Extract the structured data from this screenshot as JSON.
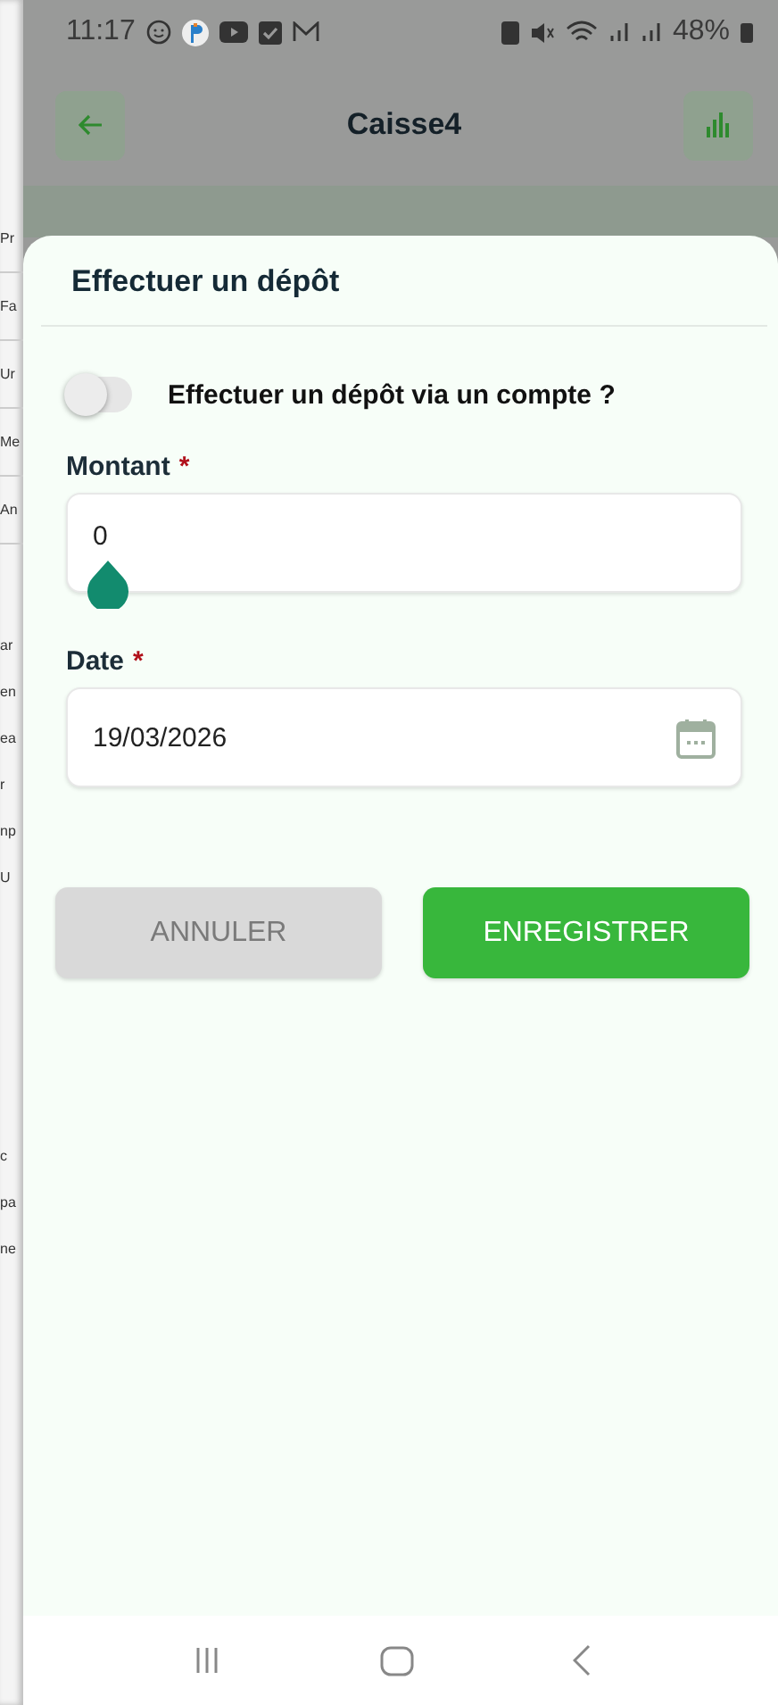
{
  "status_bar": {
    "time": "11:17",
    "battery": "48%"
  },
  "background_app": {
    "title": "Caisse4"
  },
  "side_strip": [
    {
      "text": "Pr",
      "kind": "row"
    },
    {
      "text": "Fa",
      "kind": "row"
    },
    {
      "text": "Ur",
      "kind": "row"
    },
    {
      "text": "Me",
      "kind": "row"
    },
    {
      "text": "An",
      "kind": "row"
    },
    {
      "text": "ar",
      "kind": "line"
    },
    {
      "text": "en",
      "kind": "line"
    },
    {
      "text": "ea",
      "kind": "line"
    },
    {
      "text": "r",
      "kind": "line"
    },
    {
      "text": "np",
      "kind": "line"
    },
    {
      "text": "U",
      "kind": "line"
    },
    {
      "text": "c",
      "kind": "line"
    },
    {
      "text": "pa",
      "kind": "line"
    },
    {
      "text": "ne",
      "kind": "line"
    }
  ],
  "dialog": {
    "title": "Effectuer un dépôt",
    "toggle": {
      "label": "Effectuer un dépôt via un compte ?",
      "on": false
    },
    "fields": [
      {
        "label": "Montant",
        "required_mark": "*",
        "value": "0",
        "kind": "number"
      },
      {
        "label": "Date",
        "required_mark": "*",
        "value": "19/03/2026",
        "kind": "date"
      }
    ],
    "buttons": [
      {
        "label": "ANNULER",
        "kind": "secondary"
      },
      {
        "label": "ENREGISTRER",
        "kind": "primary"
      }
    ]
  }
}
